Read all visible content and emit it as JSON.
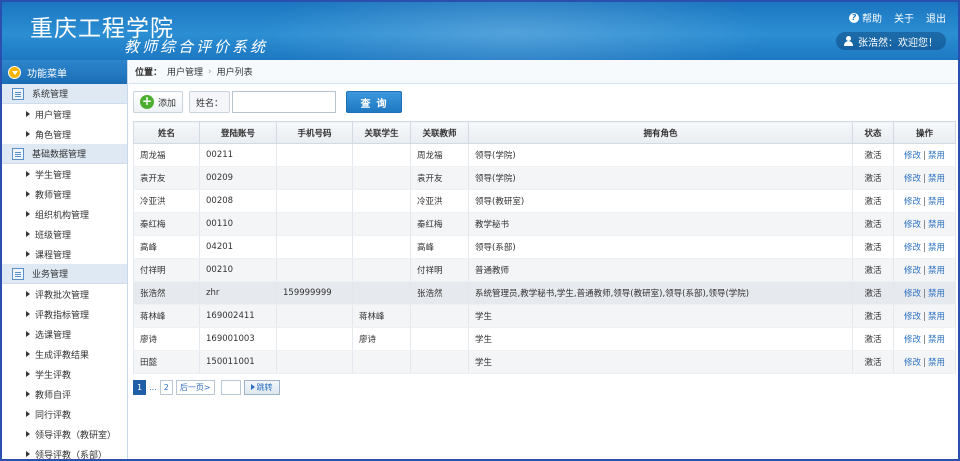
{
  "header": {
    "school_name": "重庆工程学院",
    "system_name": "教师综合评价系统",
    "help": "帮助",
    "about": "关于",
    "logout": "退出",
    "user_greeting": "张浩然：欢迎您！"
  },
  "sidebar": {
    "title": "功能菜单",
    "groups": [
      {
        "label": "系统管理",
        "items": [
          "用户管理",
          "角色管理"
        ]
      },
      {
        "label": "基础数据管理",
        "items": [
          "学生管理",
          "教师管理",
          "组织机构管理",
          "班级管理",
          "课程管理"
        ]
      },
      {
        "label": "业务管理",
        "items": [
          "评教批次管理",
          "评教指标管理",
          "选课管理",
          "生成评教结果",
          "学生评教",
          "教师自评",
          "同行评教",
          "领导评教（教研室）",
          "领导评教（系部）"
        ]
      }
    ]
  },
  "breadcrumb": {
    "label": "位置：",
    "level1": "用户管理",
    "level2": "用户列表"
  },
  "toolbar": {
    "add_label": "添加",
    "name_label": "姓名：",
    "name_value": "",
    "query_label": "查询"
  },
  "table": {
    "columns": [
      "姓名",
      "登陆账号",
      "手机号码",
      "关联学生",
      "关联教师",
      "拥有角色",
      "状态",
      "操作"
    ],
    "rows": [
      [
        "周龙福",
        "00211",
        "",
        "",
        "周龙福",
        "领导(学院)",
        "激活"
      ],
      [
        "袁开友",
        "00209",
        "",
        "",
        "袁开友",
        "领导(学院)",
        "激活"
      ],
      [
        "冷亚洪",
        "00208",
        "",
        "",
        "冷亚洪",
        "领导(教研室)",
        "激活"
      ],
      [
        "秦红梅",
        "00110",
        "",
        "",
        "秦红梅",
        "教学秘书",
        "激活"
      ],
      [
        "高峰",
        "04201",
        "",
        "",
        "高峰",
        "领导(系部)",
        "激活"
      ],
      [
        "付祥明",
        "00210",
        "",
        "",
        "付祥明",
        "普通教师",
        "激活"
      ],
      [
        "张浩然",
        "zhr",
        "159999999",
        "",
        "张浩然",
        "系统管理员,教学秘书,学生,普通教师,领导(教研室),领导(系部),领导(学院)",
        "激活"
      ],
      [
        "蒋林峰",
        "169002411",
        "",
        "蒋林峰",
        "",
        "学生",
        "激活"
      ],
      [
        "廖诗",
        "169001003",
        "",
        "廖诗",
        "",
        "学生",
        "激活"
      ],
      [
        "田懿",
        "150011001",
        "",
        "",
        "",
        "学生",
        "激活"
      ]
    ],
    "edit_label": "修改",
    "sep": "|",
    "disable_label": "禁用"
  },
  "pager": {
    "page1": "1",
    "ellipsis": "...",
    "page2": "2",
    "next": "后一页>",
    "jump_value": "",
    "go": "跳转"
  }
}
